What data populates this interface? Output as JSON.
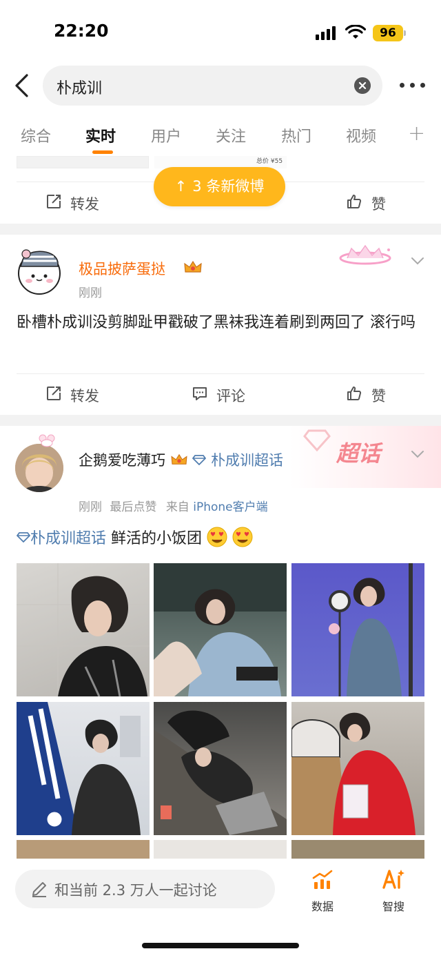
{
  "status_bar": {
    "time": "22:20",
    "battery": "96"
  },
  "search": {
    "query": "朴成训"
  },
  "tabs": [
    {
      "label": "综合",
      "active": false
    },
    {
      "label": "实时",
      "active": true
    },
    {
      "label": "用户",
      "active": false
    },
    {
      "label": "关注",
      "active": false
    },
    {
      "label": "热门",
      "active": false
    },
    {
      "label": "视频",
      "active": false
    }
  ],
  "new_posts_pill": "3 条新微博",
  "prev_post": {
    "price_tag": "总价 ¥55",
    "repost": "转发",
    "like": "赞"
  },
  "post1": {
    "username": "极品披萨蛋挞",
    "time": "刚刚",
    "content": "卧槽朴成训没剪脚趾甲戳破了黑袜我连着刷到两回了 滚行吗",
    "repost": "转发",
    "comment": "评论",
    "like": "赞"
  },
  "post2": {
    "username": "企鹅爱吃薄巧",
    "topic": "朴成训超话",
    "time": "刚刚",
    "meta": "最后点赞",
    "source_prefix": "来自",
    "source": "iPhone客户端",
    "content_topic": "朴成训超话",
    "content_text": "鲜活的小饭团",
    "badge": "超话"
  },
  "bottom": {
    "discuss_placeholder": "和当前 2.3 万人一起讨论",
    "data_label": "数据",
    "ai_label": "智搜"
  },
  "colors": {
    "accent": "#ff8200",
    "pill": "#ffb71c",
    "link": "#507daf",
    "username_orange": "#f86c0c"
  }
}
